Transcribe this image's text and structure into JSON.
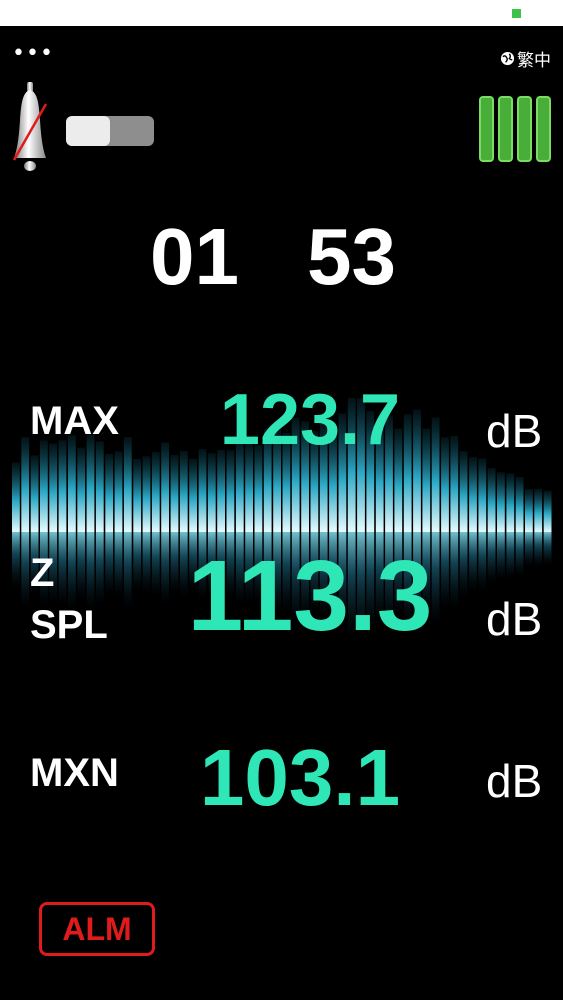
{
  "status_bar": {
    "indicator_color": "#3ec24a"
  },
  "top": {
    "menu_icon": "more-dots-icon",
    "language_label": "繁中"
  },
  "controls": {
    "bell_state": "muted",
    "toggle_on": false,
    "battery_bars": 4
  },
  "timer": {
    "minutes": "01",
    "seconds": "53"
  },
  "readings": {
    "max": {
      "label": "MAX",
      "value": "123.7",
      "unit": "dB"
    },
    "spl": {
      "label_line1": "Z",
      "label_line2": "SPL",
      "value": "113.3",
      "unit": "dB"
    },
    "mxn": {
      "label": "MXN",
      "value": "103.1",
      "unit": "dB"
    }
  },
  "alarm": {
    "label": "ALM",
    "color": "#e01b1b"
  },
  "colors": {
    "value": "#2fe6b6",
    "battery": "#49ad3a"
  }
}
